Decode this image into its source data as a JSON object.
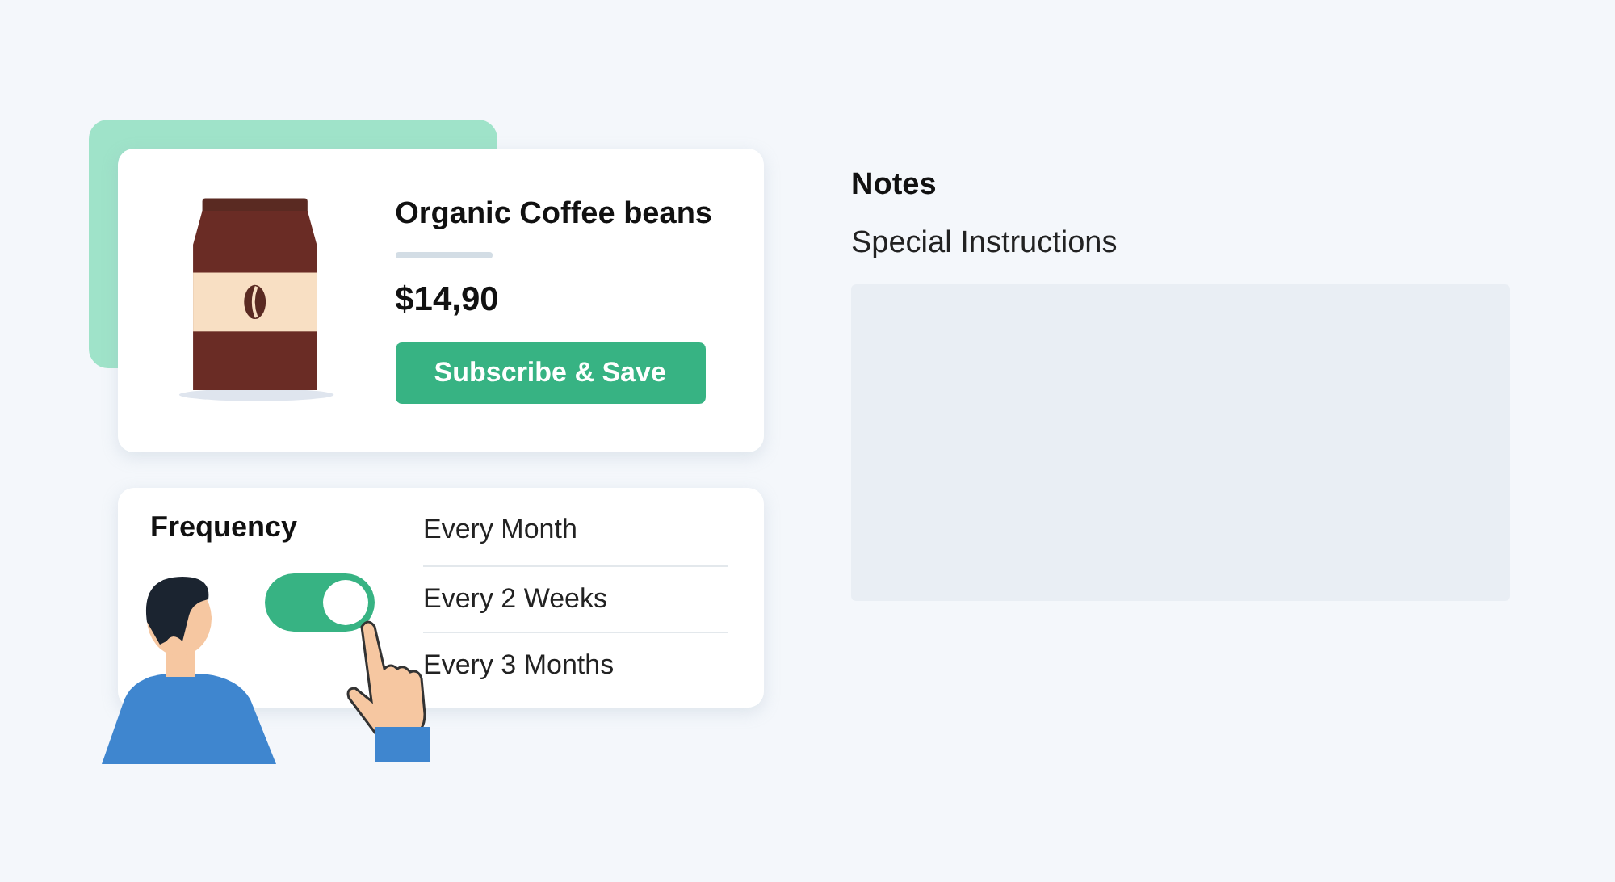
{
  "product": {
    "name": "Organic Coffee beans",
    "price": "$14,90",
    "button": "Subscribe & Save"
  },
  "frequency": {
    "title": "Frequency",
    "toggle": {
      "on": true
    },
    "options": [
      "Every Month",
      "Every 2 Weeks",
      "Every 3 Months"
    ]
  },
  "notes": {
    "title": "Notes",
    "label": "Special Instructions"
  }
}
